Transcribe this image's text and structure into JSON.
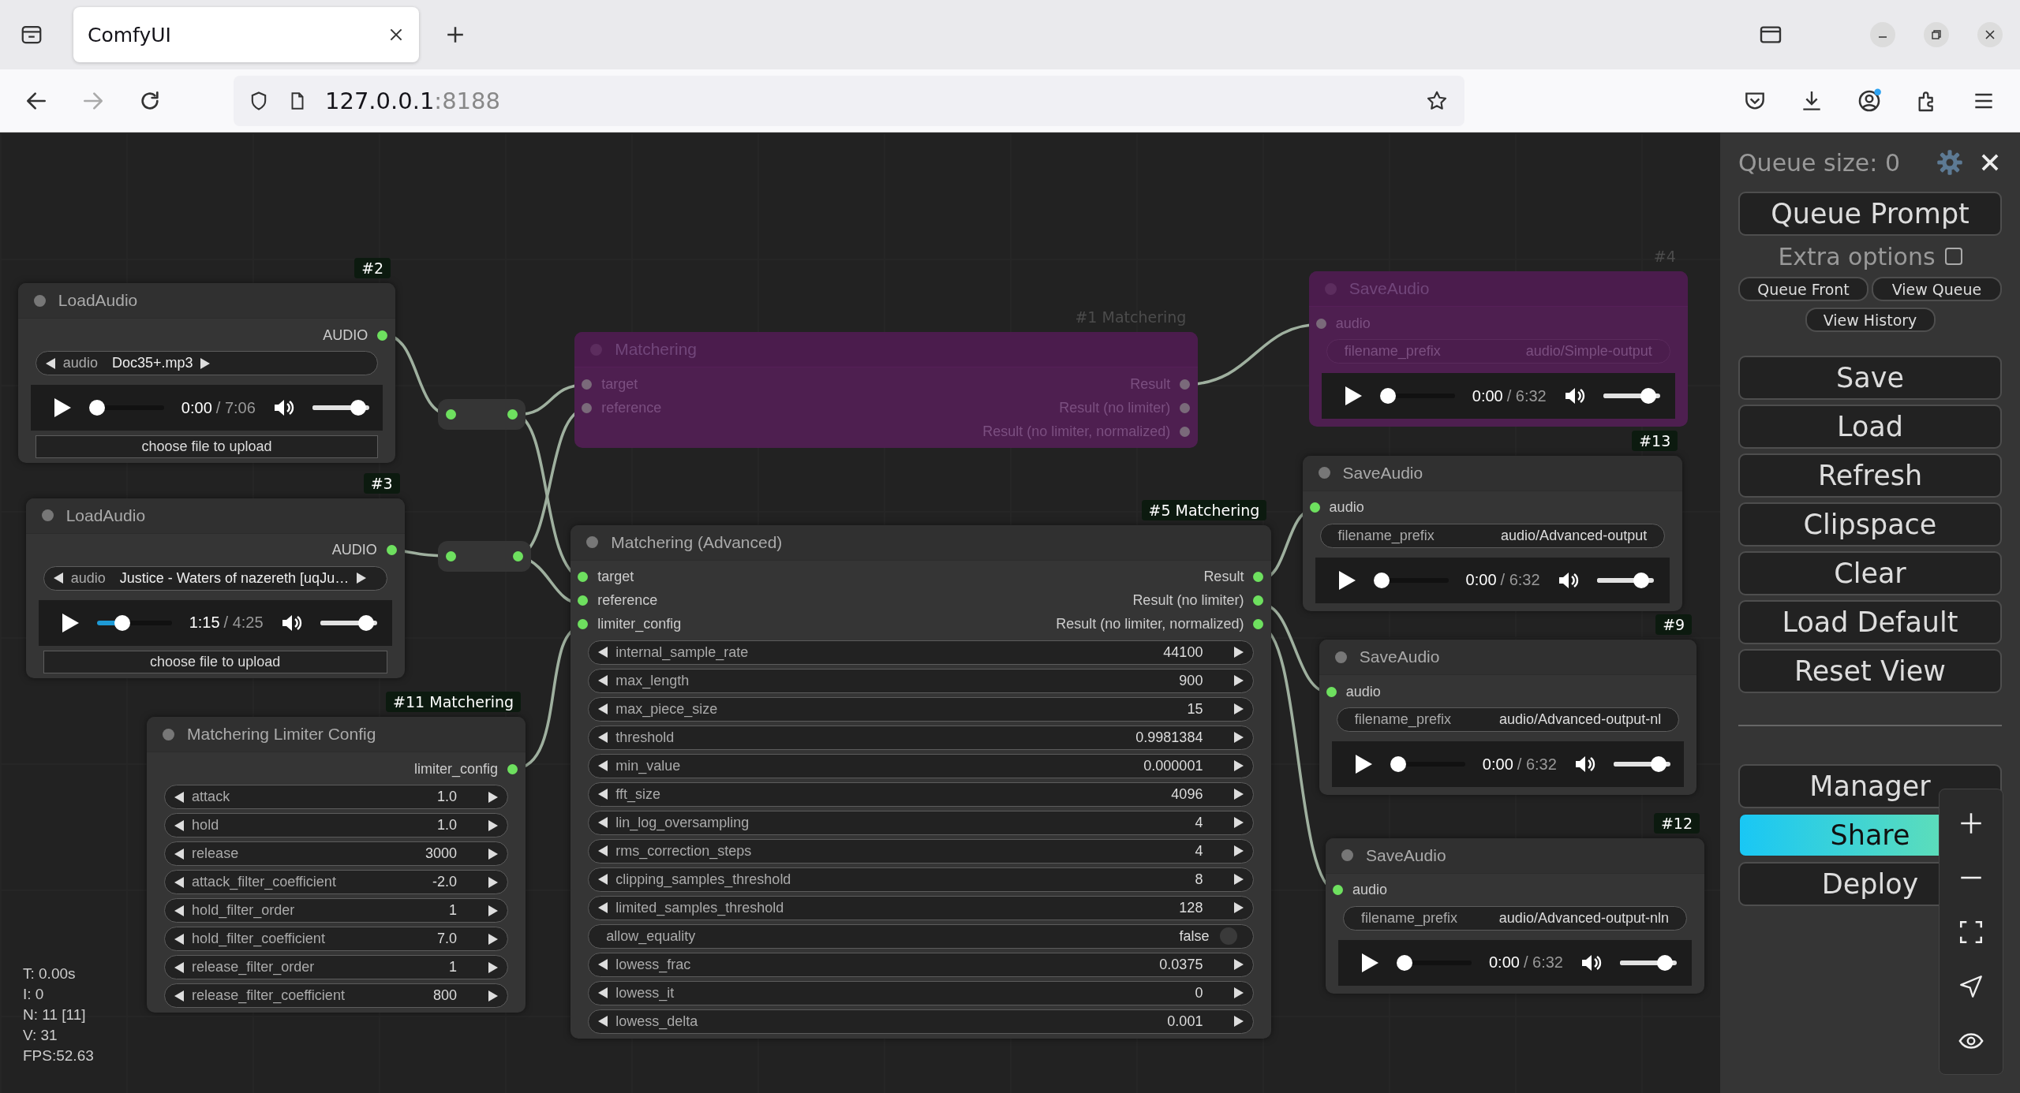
{
  "browser": {
    "tabs": [
      {
        "title": "ComfyUI",
        "selected": true
      }
    ],
    "navigation": [
      {
        "kind": "back",
        "disabled": false
      },
      {
        "kind": "forward",
        "disabled": true
      },
      {
        "kind": "reload",
        "disabled": false
      }
    ],
    "address": {
      "host": "127.0.0.1",
      "port": ":8188"
    }
  },
  "canvas": {
    "nodes": [
      {
        "kind": "node",
        "badge": "#2",
        "title": "LoadAudio",
        "bypassed": false,
        "slots": [
          {
            "output": "AUDIO"
          }
        ],
        "widgets": [
          {
            "kind": "combo",
            "label": "audio",
            "value": "Doc35+.mp3"
          },
          {
            "kind": "player",
            "time": "0:00",
            "duration": "/ 7:06",
            "progress": {
              "level": 0
            },
            "volume": {
              "level": 0.93
            }
          },
          {
            "kind": "button",
            "label": "choose file to upload"
          }
        ]
      },
      {
        "kind": "node",
        "badge": "#3",
        "title": "LoadAudio",
        "bypassed": false,
        "slots": [
          {
            "output": "AUDIO"
          }
        ],
        "widgets": [
          {
            "kind": "combo",
            "label": "audio",
            "value": "Justice - Waters of nazereth [uqJu…"
          },
          {
            "kind": "player",
            "time": "1:15",
            "duration": "/ 4:25",
            "progress": {
              "level": 0.3
            },
            "volume": {
              "level": 0.93
            }
          },
          {
            "kind": "button",
            "label": "choose file to upload"
          }
        ]
      },
      {
        "kind": "reroute"
      },
      {
        "kind": "reroute"
      },
      {
        "kind": "node",
        "badge": "#11 Matchering",
        "title": "Matchering Limiter Config",
        "bypassed": false,
        "slots": [
          {
            "output": "limiter_config"
          }
        ],
        "widgets": [
          {
            "kind": "number",
            "label": "attack",
            "value": "1.0"
          },
          {
            "kind": "number",
            "label": "hold",
            "value": "1.0"
          },
          {
            "kind": "number",
            "label": "release",
            "value": "3000"
          },
          {
            "kind": "number",
            "label": "attack_filter_coefficient",
            "value": "-2.0"
          },
          {
            "kind": "number",
            "label": "hold_filter_order",
            "value": "1"
          },
          {
            "kind": "number",
            "label": "hold_filter_coefficient",
            "value": "7.0"
          },
          {
            "kind": "number",
            "label": "release_filter_order",
            "value": "1"
          },
          {
            "kind": "number",
            "label": "release_filter_coefficient",
            "value": "800"
          }
        ]
      },
      {
        "kind": "node",
        "badge": "#1 Matchering",
        "title": "Matchering",
        "bypassed": true,
        "slots": [
          {
            "input": "target",
            "output": "Result"
          },
          {
            "input": "reference",
            "output": "Result (no limiter)"
          },
          {
            "output": "Result (no limiter, normalized)"
          }
        ]
      },
      {
        "kind": "node",
        "badge": "#5 Matchering",
        "title": "Matchering (Advanced)",
        "bypassed": false,
        "slots": [
          {
            "input": "target",
            "output": "Result"
          },
          {
            "input": "reference",
            "output": "Result (no limiter)"
          },
          {
            "input": "limiter_config",
            "output": "Result (no limiter, normalized)"
          }
        ],
        "widgets": [
          {
            "kind": "number",
            "label": "internal_sample_rate",
            "value": "44100"
          },
          {
            "kind": "number",
            "label": "max_length",
            "value": "900"
          },
          {
            "kind": "number",
            "label": "max_piece_size",
            "value": "15"
          },
          {
            "kind": "number",
            "label": "threshold",
            "value": "0.9981384"
          },
          {
            "kind": "number",
            "label": "min_value",
            "value": "0.000001"
          },
          {
            "kind": "number",
            "label": "fft_size",
            "value": "4096"
          },
          {
            "kind": "number",
            "label": "lin_log_oversampling",
            "value": "4"
          },
          {
            "kind": "number",
            "label": "rms_correction_steps",
            "value": "4"
          },
          {
            "kind": "number",
            "label": "clipping_samples_threshold",
            "value": "8"
          },
          {
            "kind": "number",
            "label": "limited_samples_threshold",
            "value": "128"
          },
          {
            "kind": "toggle",
            "label": "allow_equality",
            "value": "false",
            "on": false
          },
          {
            "kind": "number",
            "label": "lowess_frac",
            "value": "0.0375"
          },
          {
            "kind": "number",
            "label": "lowess_it",
            "value": "0"
          },
          {
            "kind": "number",
            "label": "lowess_delta",
            "value": "0.001"
          }
        ]
      },
      {
        "kind": "node",
        "badge": "#4",
        "title": "SaveAudio",
        "bypassed": true,
        "slots": [
          {
            "input": "audio"
          }
        ],
        "widgets": [
          {
            "kind": "text",
            "label": "filename_prefix",
            "value": "audio/Simple-output"
          },
          {
            "kind": "player",
            "time": "0:00",
            "duration": "/ 6:32",
            "progress": {
              "level": 0
            },
            "volume": {
              "level": 0.9
            }
          }
        ]
      },
      {
        "kind": "node",
        "badge": "#13",
        "title": "SaveAudio",
        "bypassed": false,
        "slots": [
          {
            "input": "audio"
          }
        ],
        "widgets": [
          {
            "kind": "text",
            "label": "filename_prefix",
            "value": "audio/Advanced-output"
          },
          {
            "kind": "player",
            "time": "0:00",
            "duration": "/ 6:32",
            "progress": {
              "level": 0
            },
            "volume": {
              "level": 0.9
            }
          }
        ]
      },
      {
        "kind": "node",
        "badge": "#9",
        "title": "SaveAudio",
        "bypassed": false,
        "slots": [
          {
            "input": "audio"
          }
        ],
        "widgets": [
          {
            "kind": "text",
            "label": "filename_prefix",
            "value": "audio/Advanced-output-nl"
          },
          {
            "kind": "player",
            "time": "0:00",
            "duration": "/ 6:32",
            "progress": {
              "level": 0
            },
            "volume": {
              "level": 0.9
            }
          }
        ]
      },
      {
        "kind": "node",
        "badge": "#12",
        "title": "SaveAudio",
        "bypassed": false,
        "slots": [
          {
            "input": "audio"
          }
        ],
        "widgets": [
          {
            "kind": "text",
            "label": "filename_prefix",
            "value": "audio/Advanced-output-nln"
          },
          {
            "kind": "player",
            "time": "0:00",
            "duration": "/ 6:32",
            "progress": {
              "level": 0
            },
            "volume": {
              "level": 0.9
            }
          }
        ]
      }
    ],
    "stats": [
      "T: 0.00s",
      "I: 0",
      "N: 11 [11]",
      "V: 31",
      "FPS:52.63"
    ]
  },
  "panel": {
    "queue_size": "Queue size: 0",
    "queue_button": "Queue Prompt",
    "extra_options": {
      "label": "Extra options",
      "checked": false
    },
    "queue_actions": [
      "Queue Front",
      "View Queue",
      "View History"
    ],
    "menu": [
      "Save",
      "Load",
      "Refresh",
      "Clipspace",
      "Clear",
      "Load Default",
      "Reset View"
    ],
    "extensions": [
      {
        "label": "Manager",
        "highlighted": false
      },
      {
        "label": "Share",
        "highlighted": true
      },
      {
        "label": "Deploy",
        "highlighted": false
      }
    ]
  }
}
